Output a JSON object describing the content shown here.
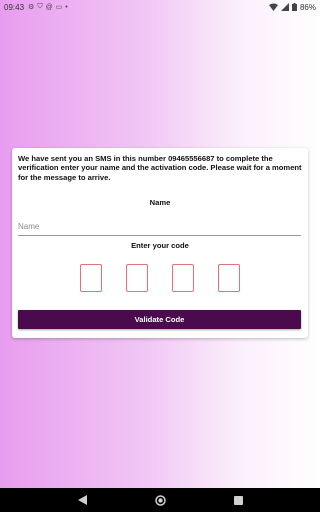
{
  "status_bar": {
    "time": "09:43",
    "left_icons": [
      "settings-icon",
      "shield-icon",
      "at-icon",
      "cast-icon",
      "dot-icon"
    ],
    "battery_text": "86%"
  },
  "card": {
    "message": "We have sent you an SMS in this number 09465556687 to complete the verification enter your name and the activation code. Please wait for a moment for the message to arrive.",
    "name_label": "Name",
    "name_placeholder": "Name",
    "code_label": "Enter your code",
    "validate_label": "Validate Code"
  },
  "colors": {
    "gradient_left": "#e89df0",
    "gradient_right": "#ffffff",
    "button": "#4a0a4d",
    "code_border": "#e57373"
  }
}
